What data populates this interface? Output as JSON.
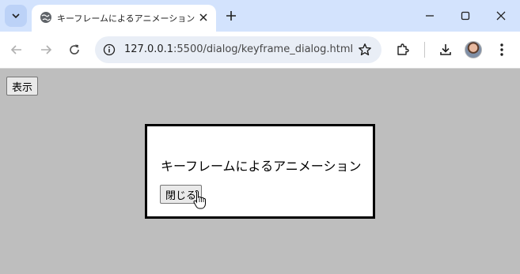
{
  "browser": {
    "tab_title": "キーフレームによるアニメーション",
    "url_host": "127.0.0.1",
    "url_path": ":5500/dialog/keyframe_dialog.html"
  },
  "page": {
    "show_button_label": "表示",
    "dialog_text": "キーフレームによるアニメーション",
    "close_button_label": "閉じる"
  }
}
